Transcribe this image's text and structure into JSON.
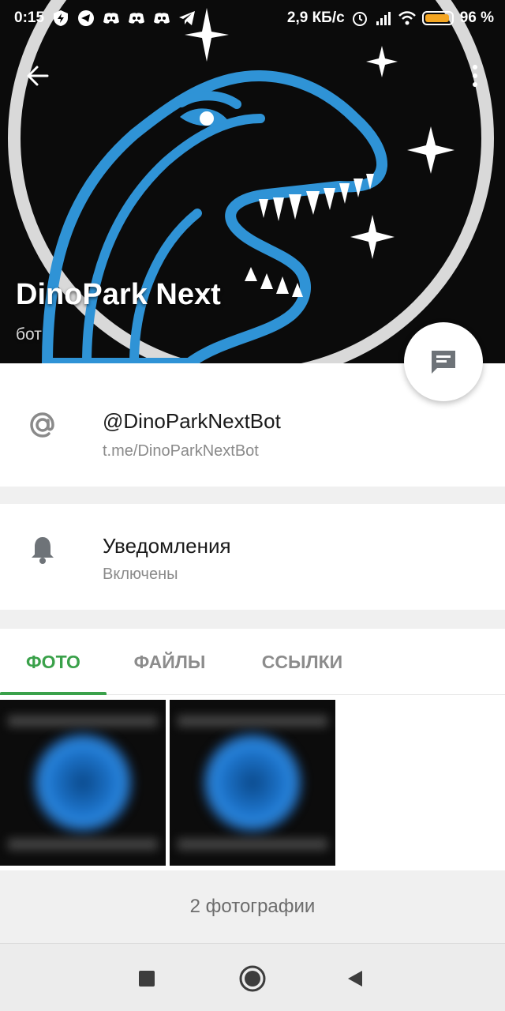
{
  "status_bar": {
    "time": "0:15",
    "net_speed": "2,9 КБ/с",
    "battery": "96 %",
    "battery_level": 0.96,
    "battery_color": "#f4a623",
    "left_icons": [
      "shield-bolt-icon",
      "telegram-icon",
      "discord-icon",
      "discord-icon",
      "discord-icon",
      "telegram-icon"
    ],
    "right_icons": [
      "alarm-icon",
      "signal-icon",
      "wifi-icon",
      "battery-icon"
    ]
  },
  "profile": {
    "name": "DinoPark Next",
    "type": "бот",
    "username": "@DinoParkNextBot",
    "link": "t.me/DinoParkNextBot"
  },
  "notifications": {
    "label": "Уведомления",
    "state": "Включены"
  },
  "tabs": [
    {
      "label": "ФОТО",
      "active": true
    },
    {
      "label": "ФАЙЛЫ",
      "active": false
    },
    {
      "label": "ССЫЛКИ",
      "active": false
    }
  ],
  "media_count_label": "2 фотографии",
  "colors": {
    "accent": "#3aa14a",
    "dino_blue": "#2f93d6",
    "header_bg": "#0b0b0b"
  }
}
